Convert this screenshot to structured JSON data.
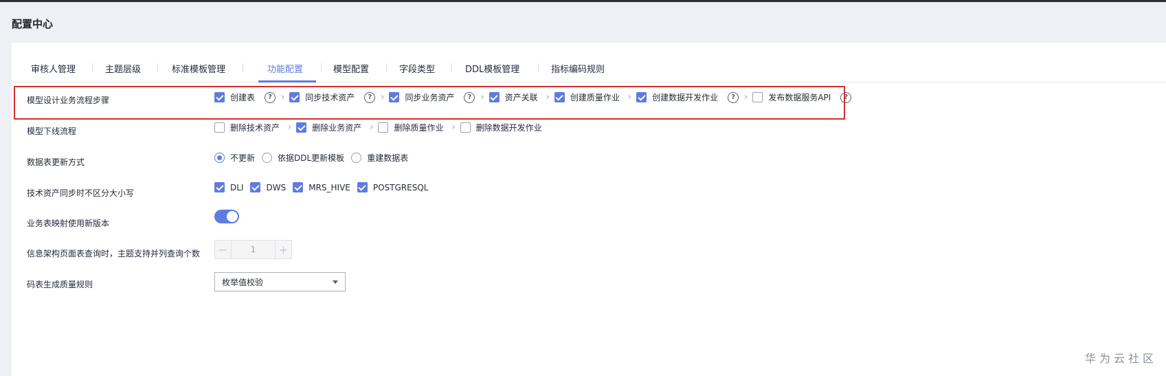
{
  "page_title": "配置中心",
  "tabs": [
    {
      "label": "审核人管理"
    },
    {
      "label": "主题层级"
    },
    {
      "label": "标准模板管理"
    },
    {
      "label": "功能配置",
      "active": true
    },
    {
      "label": "模型配置"
    },
    {
      "label": "字段类型"
    },
    {
      "label": "DDL模板管理"
    },
    {
      "label": "指标编码规则"
    }
  ],
  "rows": {
    "flow": {
      "label": "模型设计业务流程步骤",
      "options": [
        {
          "label": "创建表",
          "checked": true
        },
        {
          "label": "同步技术资产",
          "checked": true
        },
        {
          "label": "同步业务资产",
          "checked": true
        },
        {
          "label": "资产关联",
          "checked": true
        },
        {
          "label": "创建质量作业",
          "checked": true
        },
        {
          "label": "创建数据开发作业",
          "checked": true
        },
        {
          "label": "发布数据服务API",
          "checked": false
        }
      ]
    },
    "offline": {
      "label": "模型下线流程",
      "options": [
        {
          "label": "删除技术资产",
          "checked": false
        },
        {
          "label": "删除业务资产",
          "checked": true
        },
        {
          "label": "删除质量作业",
          "checked": false
        },
        {
          "label": "删除数据开发作业",
          "checked": false
        }
      ]
    },
    "update": {
      "label": "数据表更新方式",
      "options": [
        {
          "label": "不更新",
          "selected": true
        },
        {
          "label": "依据DDL更新模板",
          "selected": false
        },
        {
          "label": "重建数据表",
          "selected": false
        }
      ]
    },
    "case": {
      "label": "技术资产同步时不区分大小写",
      "options": [
        {
          "label": "DLI",
          "checked": true
        },
        {
          "label": "DWS",
          "checked": true
        },
        {
          "label": "MRS_HIVE",
          "checked": true
        },
        {
          "label": "POSTGRESQL",
          "checked": true
        }
      ]
    },
    "mapping": {
      "label": "业务表映射使用新版本",
      "enabled": true
    },
    "query": {
      "label": "信息架构页面表查询时，主题支持并列查询个数",
      "value": "1",
      "minus": "−",
      "plus": "+"
    },
    "quality": {
      "label": "码表生成质量规则",
      "selected": "枚举值校验"
    }
  },
  "watermark": "华为云社区",
  "colors": {
    "accent": "#5e7ce0",
    "highlight": "#d32f2f"
  },
  "icons": {
    "help": "question-circle-icon",
    "arrow": "chevron-right-icon",
    "caret": "caret-down-icon"
  }
}
